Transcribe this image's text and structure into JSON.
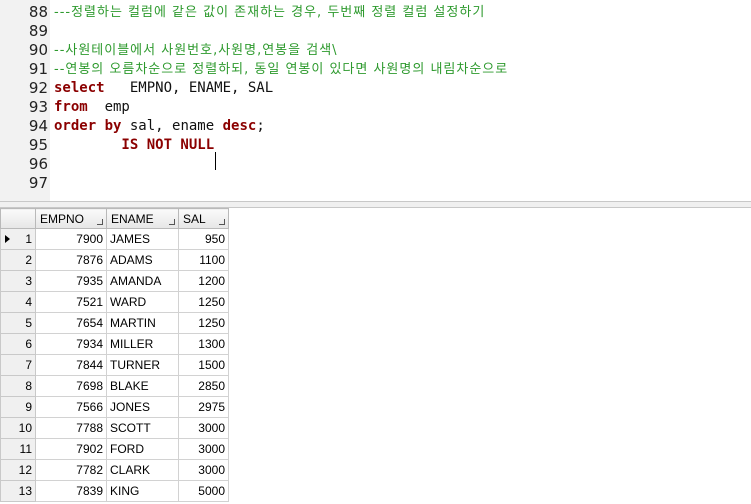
{
  "editor": {
    "lines": [
      {
        "n": "88",
        "parts": [
          {
            "t": "---정렬하는 컬럼에 같은 값이 존재하는 경우, 두번째 정렬 컬럼 설정하기",
            "c": "cm"
          }
        ]
      },
      {
        "n": "89",
        "parts": []
      },
      {
        "n": "90",
        "parts": [
          {
            "t": "--사원테이블에서 사원번호,사원명,연봉을 검색\\",
            "c": "cm"
          }
        ]
      },
      {
        "n": "91",
        "parts": [
          {
            "t": "--연봉의 오름차순으로 정렬하되, 동일 연봉이 있다면 사원명의 내림차순으로",
            "c": "cm"
          }
        ]
      },
      {
        "n": "92",
        "parts": [
          {
            "t": "select",
            "c": "kw"
          },
          {
            "t": "   EMPNO, ENAME, SAL",
            "c": "tx"
          }
        ]
      },
      {
        "n": "93",
        "parts": [
          {
            "t": "from",
            "c": "kw"
          },
          {
            "t": "  emp",
            "c": "tx"
          }
        ]
      },
      {
        "n": "94",
        "parts": [
          {
            "t": "order by",
            "c": "kw"
          },
          {
            "t": " sal, ename ",
            "c": "tx"
          },
          {
            "t": "desc",
            "c": "kw"
          },
          {
            "t": ";",
            "c": "tx"
          }
        ]
      },
      {
        "n": "95",
        "parts": [
          {
            "t": "        IS NOT NULL",
            "c": "kw"
          }
        ]
      },
      {
        "n": "96",
        "parts": []
      },
      {
        "n": "97",
        "parts": []
      }
    ]
  },
  "grid": {
    "columns": [
      "EMPNO",
      "ENAME",
      "SAL"
    ],
    "rows": [
      [
        "1",
        "7900",
        "JAMES",
        "950"
      ],
      [
        "2",
        "7876",
        "ADAMS",
        "1100"
      ],
      [
        "3",
        "7935",
        "AMANDA",
        "1200"
      ],
      [
        "4",
        "7521",
        "WARD",
        "1250"
      ],
      [
        "5",
        "7654",
        "MARTIN",
        "1250"
      ],
      [
        "6",
        "7934",
        "MILLER",
        "1300"
      ],
      [
        "7",
        "7844",
        "TURNER",
        "1500"
      ],
      [
        "8",
        "7698",
        "BLAKE",
        "2850"
      ],
      [
        "9",
        "7566",
        "JONES",
        "2975"
      ],
      [
        "10",
        "7788",
        "SCOTT",
        "3000"
      ],
      [
        "11",
        "7902",
        "FORD",
        "3000"
      ],
      [
        "12",
        "7782",
        "CLARK",
        "3000"
      ],
      [
        "13",
        "7839",
        "KING",
        "5000"
      ]
    ],
    "current_row": 0
  }
}
